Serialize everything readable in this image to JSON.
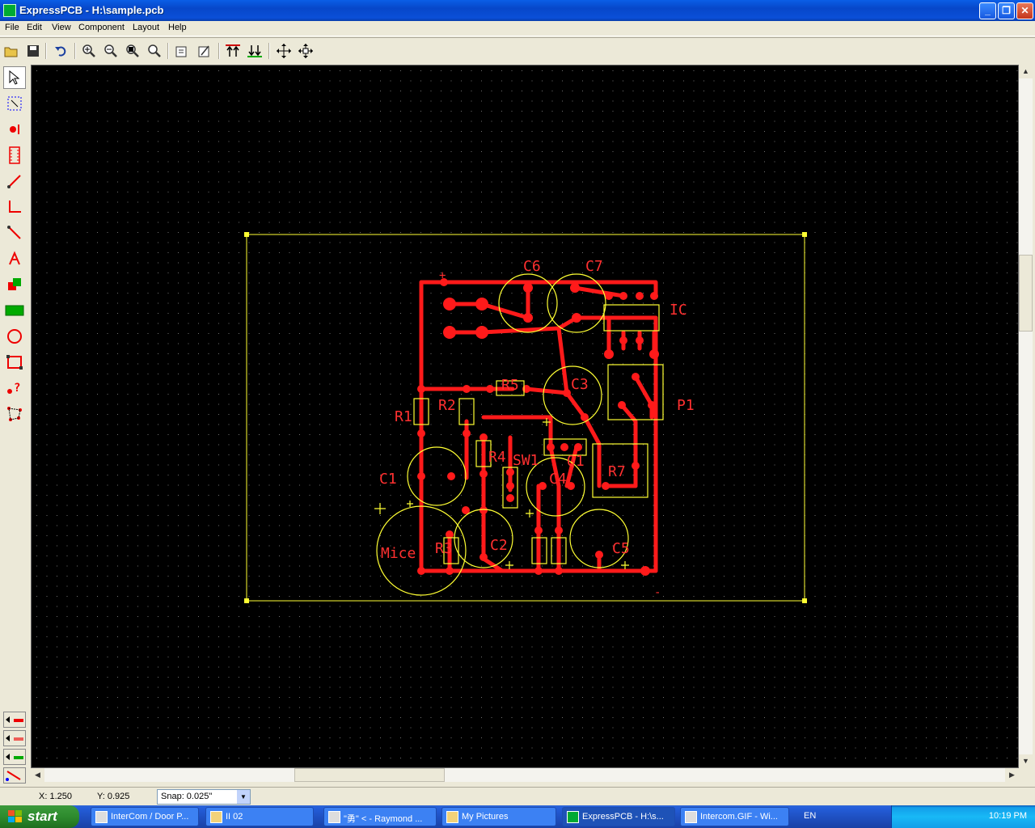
{
  "window": {
    "title": "ExpressPCB - H:\\sample.pcb",
    "controls": [
      "minimize",
      "maximize",
      "close"
    ]
  },
  "menu": [
    "File",
    "Edit",
    "View",
    "Component",
    "Layout",
    "Help"
  ],
  "toolbar": {
    "buttons": [
      "open-icon",
      "save-icon",
      "undo-icon",
      "zoom-in-icon",
      "zoom-out-icon",
      "zoom-fit-icon",
      "zoom-window-icon",
      "properties-icon",
      "properties2-icon",
      "top-layer-icon",
      "bottom-layer-icon",
      "move-icon",
      "move-all-icon"
    ]
  },
  "left_tools": [
    "pointer-icon",
    "select-area-icon",
    "pad-icon",
    "component-icon",
    "trace-icon",
    "corner-trace-icon",
    "line-icon",
    "text-icon",
    "layer-swap-icon",
    "fill-icon",
    "circle-icon",
    "rectangle-icon",
    "query-icon",
    "net-icon"
  ],
  "layer_buttons": [
    "top-layer-tab",
    "bottom-layer-tab",
    "silkscreen-tab",
    "rats-nest-tab"
  ],
  "pcb": {
    "labels": [
      "C6",
      "C7",
      "IC",
      "R5",
      "C3",
      "P1",
      "R1",
      "R2",
      "R4",
      "SW1",
      "Q1",
      "R7",
      "C1",
      "C4",
      "Mice",
      "R3",
      "C2",
      "C5"
    ],
    "plus": "+",
    "minus": "-"
  },
  "status": {
    "x": "X: 1.250",
    "y": "Y: 0.925",
    "snap": "Snap:  0.025\""
  },
  "taskbar": {
    "start": "start",
    "tasks": [
      "InterCom / Door P...",
      "II 02",
      "\"勇\" < - Raymond ...",
      "My Pictures",
      "ExpressPCB - H:\\s...",
      "Intercom.GIF - Wi..."
    ],
    "lang": "EN",
    "clock": "10:19 PM"
  },
  "colors": {
    "trace": "#ff1a1a",
    "silkscreen": "#ffff33",
    "background": "#000000",
    "grid": "#707070"
  }
}
